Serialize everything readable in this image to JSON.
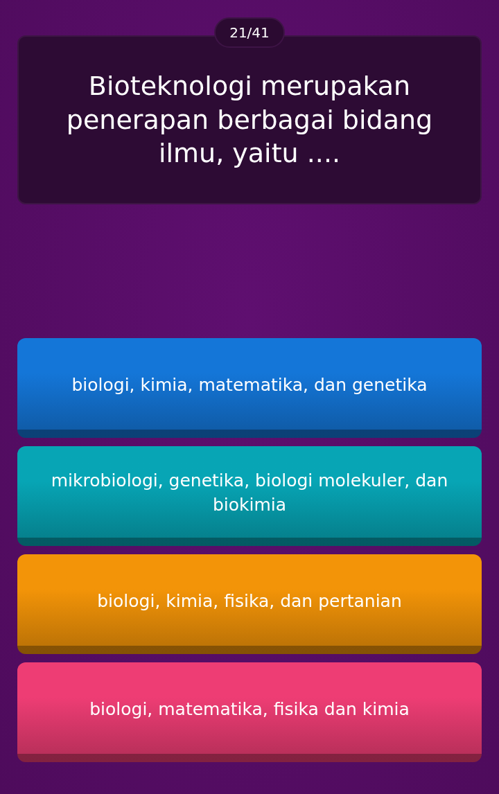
{
  "counter": "21/41",
  "question": "Bioteknologi merupakan penerapan berbagai bidang ilmu, yaitu ....",
  "options": [
    {
      "text": "biologi, kimia, matematika, dan genetika",
      "color": "#1476d8"
    },
    {
      "text": "mikrobiologi, genetika, biologi molekuler, dan biokimia",
      "color": "#07a5b5"
    },
    {
      "text": "biologi, kimia, fisika, dan pertanian",
      "color": "#f39408"
    },
    {
      "text": "biologi, matematika, fisika dan kimia",
      "color": "#ee3d74"
    }
  ]
}
